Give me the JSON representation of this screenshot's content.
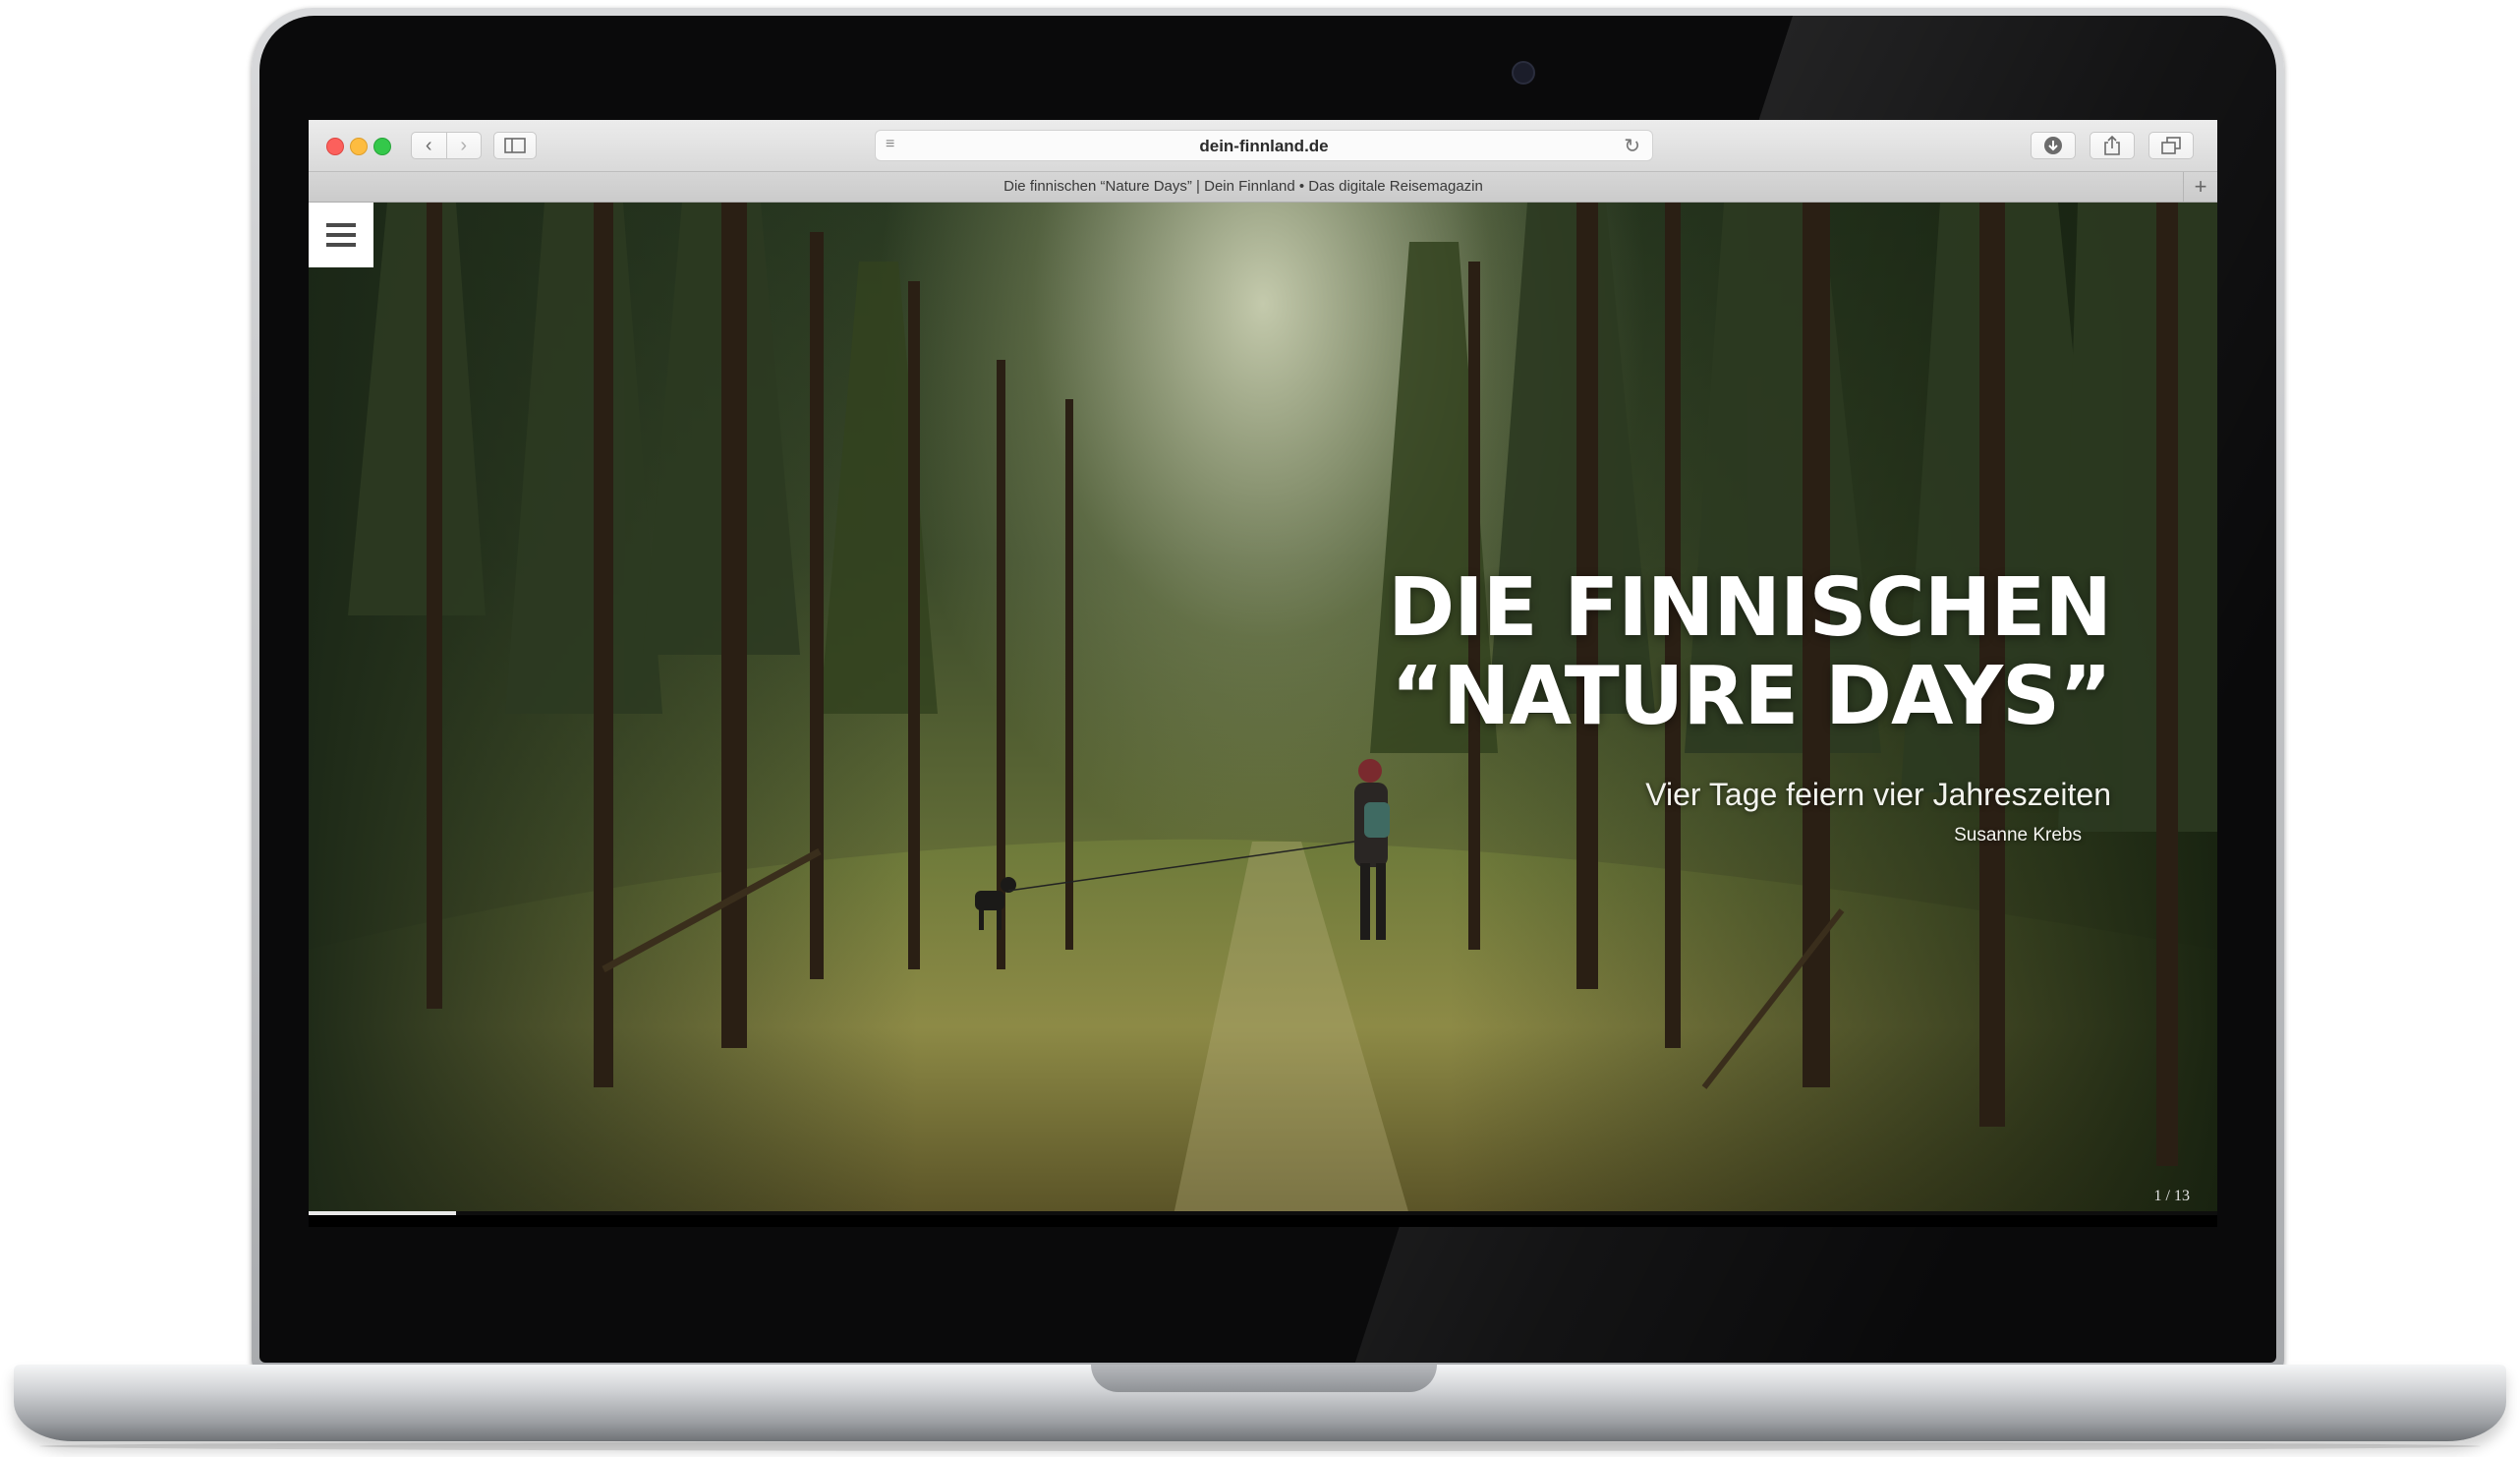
{
  "browser": {
    "url": "dein-finnland.de",
    "tab_title": "Die finnischen “Nature Days” | Dein Finnland • Das digitale Reisemagazin",
    "icons": {
      "back": "chevron-left-icon",
      "forward": "chevron-right-icon",
      "sidebar": "sidebar-icon",
      "reader": "reader-icon",
      "reload": "reload-icon",
      "download": "download-icon",
      "share": "share-icon",
      "tabs": "tabs-icon",
      "new_tab": "plus-icon"
    }
  },
  "page": {
    "menu_icon": "hamburger-icon",
    "hero": {
      "title": "DIE FINNISCHEN “NATURE DAYS”",
      "subtitle": "Vier Tage feiern vier Jahreszeiten",
      "author": "Susanne Krebs"
    },
    "slide_counter": "1 / 13",
    "slide_progress": 0.077
  },
  "colors": {
    "traffic_close": "#fc605c",
    "traffic_minimize": "#fdbc40",
    "traffic_maximize": "#34c84a",
    "hero_text": "#ffffff"
  }
}
